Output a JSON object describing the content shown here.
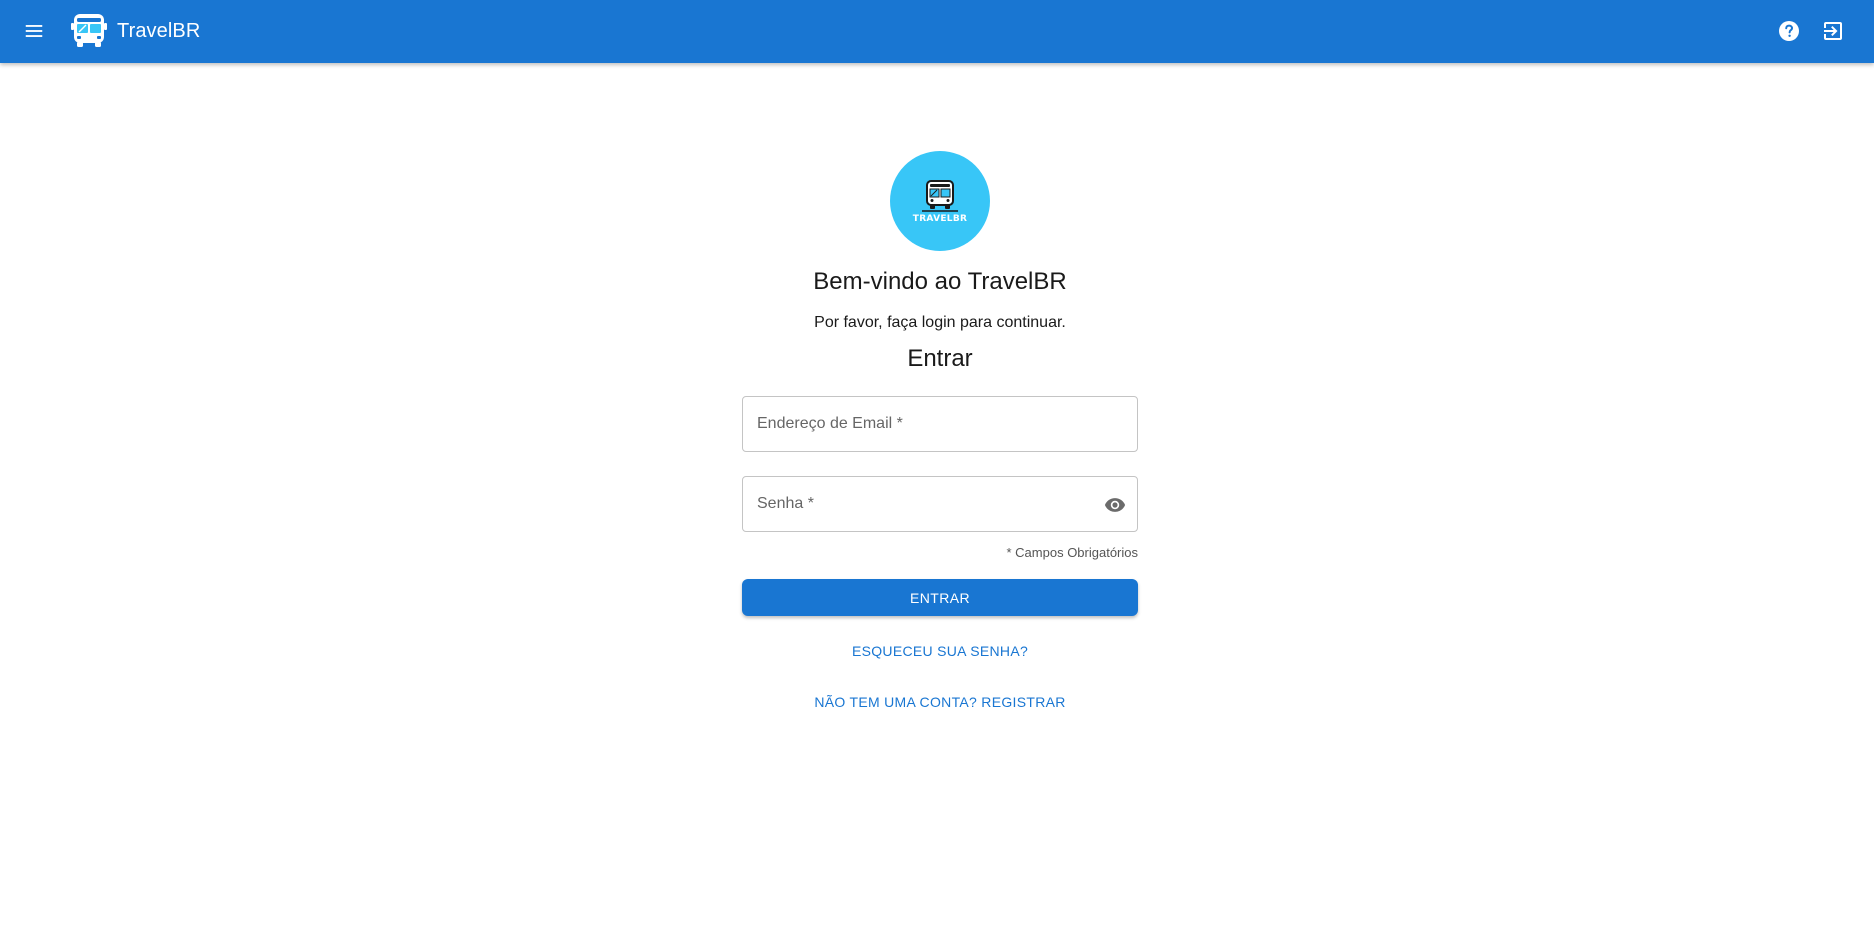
{
  "appbar": {
    "menu_icon": "menu-icon",
    "brand_icon": "bus-icon",
    "title": "TravelBR",
    "help_icon": "help-circle-icon",
    "logout_icon": "logout-icon",
    "background_color": "#1976d2"
  },
  "login": {
    "logo_text": "TRAVELBR",
    "logo_color": "#38c6f7",
    "welcome": "Bem-vindo ao TravelBR",
    "subtitle": "Por favor, faça login para continuar.",
    "form_title": "Entrar",
    "email": {
      "placeholder": "Endereço de Email *",
      "value": ""
    },
    "password": {
      "placeholder": "Senha *",
      "value": "",
      "toggle_icon": "eye-icon"
    },
    "required_note": "* Campos Obrigatórios",
    "submit_label": "ENTRAR",
    "forgot_label": "ESQUECEU SUA SENHA?",
    "register_label": "NÃO TEM UMA CONTA? REGISTRAR",
    "accent_color": "#1976d2"
  }
}
